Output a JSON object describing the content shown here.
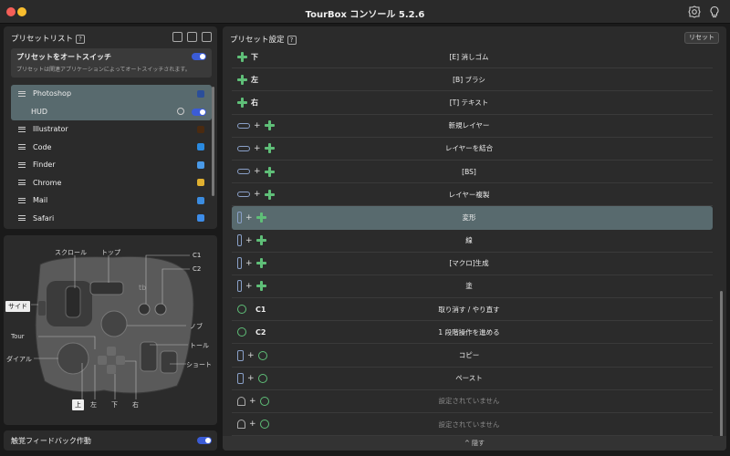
{
  "window": {
    "title": "TourBox コンソール 5.2.6"
  },
  "preset_list": {
    "title": "プリセットリスト",
    "help": "?",
    "auto_switch": {
      "label": "プリセットをオートスイッチ",
      "description": "プリセットは関連アプリケーションによってオートスイッチされます。",
      "enabled": true
    },
    "apps": [
      {
        "name": "Photoshop",
        "icon": "photoshop-icon",
        "color": "#2b6bd8",
        "selected": true
      },
      {
        "name": "HUD",
        "sub": true,
        "enabled": true
      },
      {
        "name": "Illustrator",
        "icon": "illustrator-icon",
        "color": "#d9661a"
      },
      {
        "name": "Code",
        "icon": "vscode-icon",
        "color": "#2a8ae0"
      },
      {
        "name": "Finder",
        "icon": "finder-icon",
        "color": "#4a9ae8"
      },
      {
        "name": "Chrome",
        "icon": "chrome-icon",
        "color": "#e0b030"
      },
      {
        "name": "Mail",
        "icon": "mail-icon",
        "color": "#3b8ce0"
      },
      {
        "name": "Safari",
        "icon": "safari-icon",
        "color": "#3d8ce8"
      }
    ]
  },
  "device": {
    "labels": {
      "scroll": "スクロール",
      "top": "トップ",
      "c1": "C1",
      "c2": "C2",
      "side": "サイド",
      "knob": "ノブ",
      "tour": "Tour",
      "tall": "トール",
      "dial": "ダイアル",
      "short": "ショート",
      "up": "上",
      "left": "左",
      "down": "下",
      "right": "右"
    },
    "logo_text": "tb"
  },
  "haptic": {
    "label": "触覚フィードバック作動",
    "enabled": true
  },
  "preset_settings": {
    "title": "プリセット設定",
    "help": "?",
    "reset_label": "リセット",
    "rows": [
      {
        "icon": "dpad",
        "key": "下",
        "action": "[E] 消しゴム"
      },
      {
        "icon": "dpad",
        "key": "左",
        "action": "[B] ブラシ"
      },
      {
        "icon": "dpad",
        "key": "右",
        "action": "[T] テキスト"
      },
      {
        "icon": "long",
        "combo": true,
        "action": "新規レイヤー"
      },
      {
        "icon": "long",
        "combo": true,
        "action": "レイヤーを結合"
      },
      {
        "icon": "long",
        "combo": true,
        "action": "[BS]"
      },
      {
        "icon": "long",
        "combo": true,
        "action": "レイヤー複製"
      },
      {
        "icon": "side",
        "combo": true,
        "action": "変形",
        "selected": true
      },
      {
        "icon": "side",
        "combo": true,
        "action": "線"
      },
      {
        "icon": "side",
        "combo": true,
        "action": "[マクロ]生成"
      },
      {
        "icon": "side",
        "combo": true,
        "action": "塗"
      },
      {
        "icon": "circle",
        "key": "C1",
        "action": "取り消す / やり直す"
      },
      {
        "icon": "circle",
        "key": "C2",
        "action": "1 段階操作を進める"
      },
      {
        "icon": "tall",
        "combo": true,
        "second": "circle",
        "action": "コピー"
      },
      {
        "icon": "tall",
        "combo": true,
        "second": "circle",
        "action": "ペースト"
      },
      {
        "icon": "bell",
        "combo": true,
        "second": "circle",
        "action": "設定されていません",
        "muted": true
      },
      {
        "icon": "bell",
        "combo": true,
        "second": "circle",
        "action": "設定されていません",
        "muted": true
      }
    ],
    "collapse_label": "^ 隠す"
  }
}
